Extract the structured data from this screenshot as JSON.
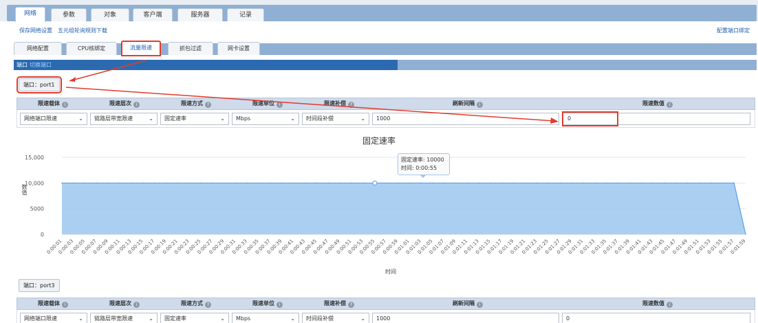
{
  "top_tabs": [
    "网络",
    "参数",
    "对象",
    "客户端",
    "服务器",
    "记录"
  ],
  "active_top_tab": "网络",
  "links": {
    "save_network": "保存网络设置",
    "five_tuple_download": "五元组轮询规则下载",
    "config_port_binding": "配置端口绑定"
  },
  "sub_tabs": [
    "网络配置",
    "CPU核绑定",
    "流量限速",
    "抓包过滤",
    "网卡设置"
  ],
  "active_sub_tab": "流量限速",
  "port_strip": {
    "label": "端口",
    "switch_label": "切换端口"
  },
  "ports": [
    {
      "button": "端口：port1",
      "headers": [
        "限速载体",
        "限速层次",
        "限速方式",
        "限速单位",
        "限速补偿",
        "刷新间隔",
        "限速数值"
      ],
      "values": {
        "carrier": "网络端口限速",
        "layer": "链路层带宽限速",
        "mode": "固定速率",
        "unit": "Mbps",
        "compensation": "时间段补偿",
        "refresh": "1000",
        "limit": "0"
      }
    },
    {
      "button": "端口：port3",
      "headers": [
        "限速载体",
        "限速层次",
        "限速方式",
        "限速单位",
        "限速补偿",
        "刷新间隔",
        "限速数值"
      ],
      "values": {
        "carrier": "网络端口限速",
        "layer": "链路层带宽限速",
        "mode": "固定速率",
        "unit": "Mbps",
        "compensation": "时间段补偿",
        "refresh": "1000",
        "limit": "0"
      }
    }
  ],
  "tooltip": {
    "line1": "固定速率: 10000",
    "line2": "时间: 0:00:55"
  },
  "colors": {
    "accent": "#1f5fb0",
    "highlight": "#e23b2d",
    "area": "#9cc7ef",
    "line": "#5aa0e6"
  },
  "chart_data": {
    "type": "area",
    "title": "固定速率",
    "xlabel": "时间",
    "ylabel": "数值",
    "ylim": [
      0,
      15000
    ],
    "yticks": [
      "0",
      "5000",
      "10,000",
      "15,000"
    ],
    "x": [
      "0:00:01",
      "0:00:03",
      "0:00:05",
      "0:00:07",
      "0:00:09",
      "0:00:11",
      "0:00:13",
      "0:00:15",
      "0:00:17",
      "0:00:19",
      "0:00:21",
      "0:00:23",
      "0:00:25",
      "0:00:27",
      "0:00:29",
      "0:00:31",
      "0:00:33",
      "0:00:35",
      "0:00:37",
      "0:00:39",
      "0:00:41",
      "0:00:43",
      "0:00:45",
      "0:00:47",
      "0:00:49",
      "0:00:51",
      "0:00:53",
      "0:00:55",
      "0:00:57",
      "0:00:59",
      "0:01:01",
      "0:01:03",
      "0:01:05",
      "0:01:07",
      "0:01:09",
      "0:01:11",
      "0:01:13",
      "0:01:15",
      "0:01:17",
      "0:01:19",
      "0:01:21",
      "0:01:23",
      "0:01:25",
      "0:01:27",
      "0:01:29",
      "0:01:31",
      "0:01:33",
      "0:01:35",
      "0:01:37",
      "0:01:39",
      "0:01:41",
      "0:01:43",
      "0:01:45",
      "0:01:47",
      "0:01:49",
      "0:01:51",
      "0:01:53",
      "0:01:55",
      "0:01:57",
      "0:01:59"
    ],
    "series": [
      {
        "values": [
          10000,
          10000,
          10000,
          10000,
          10000,
          10000,
          10000,
          10000,
          10000,
          10000,
          10000,
          10000,
          10000,
          10000,
          10000,
          10000,
          10000,
          10000,
          10000,
          10000,
          10000,
          10000,
          10000,
          10000,
          10000,
          10000,
          10000,
          10000,
          10000,
          10000,
          10000,
          10000,
          10000,
          10000,
          10000,
          10000,
          10000,
          10000,
          10000,
          10000,
          10000,
          10000,
          10000,
          10000,
          10000,
          10000,
          10000,
          10000,
          10000,
          10000,
          10000,
          10000,
          10000,
          10000,
          10000,
          10000,
          10000,
          10000,
          10000,
          0
        ]
      }
    ],
    "grid": true,
    "legend": "none"
  }
}
